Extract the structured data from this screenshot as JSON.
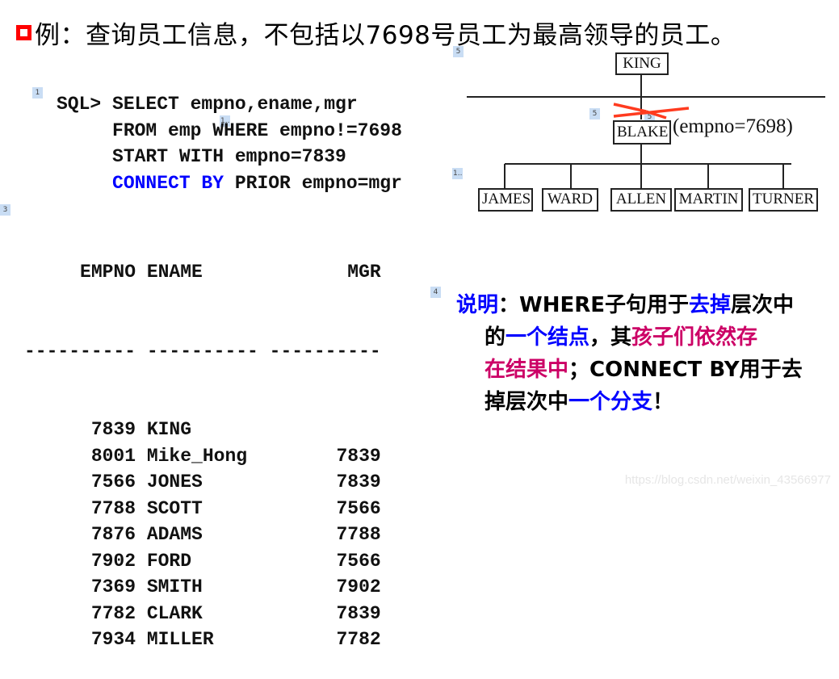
{
  "title": {
    "bullet_icon": "red-hollow-square",
    "text": "例：查询员工信息，不包括以7698号员工为最高领导的员工。"
  },
  "code": {
    "lines": [
      [
        {
          "t": "SQL> SELECT empno,ename,mgr",
          "c": ""
        }
      ],
      [
        {
          "t": "     FROM emp WHERE empno!=7698",
          "c": ""
        }
      ],
      [
        {
          "t": "     START WITH empno=7839",
          "c": ""
        }
      ],
      [
        {
          "t": "     CONNECT BY",
          "c": "kw"
        },
        {
          "t": " PRIOR empno=mgr",
          "c": ""
        }
      ]
    ]
  },
  "result": {
    "header": "     EMPNO ENAME             MGR",
    "separator": "---------- ---------- ----------",
    "rows": [
      {
        "empno": "7839",
        "ename": "KING",
        "mgr": ""
      },
      {
        "empno": "8001",
        "ename": "Mike_Hong",
        "mgr": "7839"
      },
      {
        "empno": "7566",
        "ename": "JONES",
        "mgr": "7839"
      },
      {
        "empno": "7788",
        "ename": "SCOTT",
        "mgr": "7566"
      },
      {
        "empno": "7876",
        "ename": "ADAMS",
        "mgr": "7788"
      },
      {
        "empno": "7902",
        "ename": "FORD",
        "mgr": "7566"
      },
      {
        "empno": "7369",
        "ename": "SMITH",
        "mgr": "7902"
      },
      {
        "empno": "7782",
        "ename": "CLARK",
        "mgr": "7839"
      },
      {
        "empno": "7934",
        "ename": "MILLER",
        "mgr": "7782"
      }
    ]
  },
  "diagram": {
    "root": "KING",
    "middle": "BLAKE",
    "middle_annotation": "(empno=7698)",
    "children": [
      "JAMES",
      "WARD",
      "ALLEN",
      "MARTIN",
      "TURNER"
    ],
    "cut_mark_color": "#ff3b1f"
  },
  "tags": [
    "1",
    "1..",
    "1..",
    "3",
    "4",
    "5",
    "5",
    "5"
  ],
  "note": {
    "lines": [
      [
        {
          "t": "说明",
          "c": "blue"
        },
        {
          "t": "：WHERE子句用于",
          "c": "black"
        },
        {
          "t": "去掉",
          "c": "blue"
        },
        {
          "t": "层次中",
          "c": "black"
        }
      ],
      [
        {
          "t": "的",
          "c": "black"
        },
        {
          "t": "一个结点",
          "c": "blue"
        },
        {
          "t": "，其",
          "c": "black"
        },
        {
          "t": "孩子们依然存",
          "c": "magenta"
        }
      ],
      [
        {
          "t": "在结果中",
          "c": "magenta"
        },
        {
          "t": "；CONNECT BY用于去",
          "c": "black"
        }
      ],
      [
        {
          "t": "掉层次中",
          "c": "black"
        },
        {
          "t": "一个分支",
          "c": "blue"
        },
        {
          "t": "！",
          "c": "black"
        }
      ]
    ]
  },
  "watermark": "https://blog.csdn.net/weixin_43566977"
}
